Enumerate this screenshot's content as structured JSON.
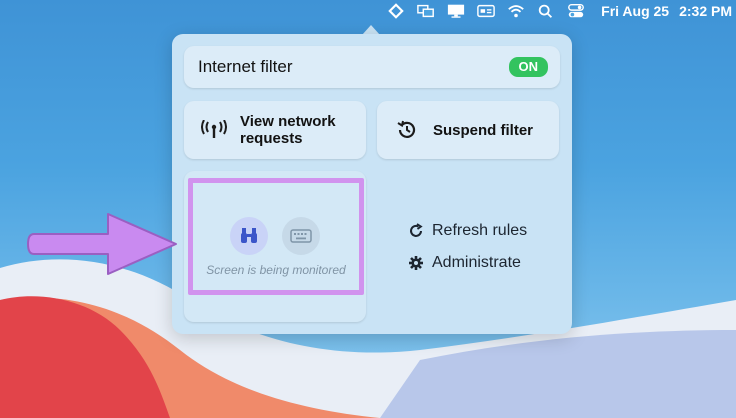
{
  "menubar": {
    "icons": [
      "app-diamond-icon",
      "screen-mirror-icon",
      "display-icon",
      "card-icon",
      "wifi-icon",
      "search-icon",
      "control-center-icon"
    ],
    "date": "Fri Aug 25",
    "time": "2:32 PM"
  },
  "panel": {
    "filter": {
      "label": "Internet filter",
      "toggle": "ON"
    },
    "network_button": {
      "line1": "View network",
      "line2": "requests"
    },
    "suspend_button": {
      "label": "Suspend filter"
    },
    "monitor": {
      "status": "Screen is being monitored"
    },
    "refresh_label": "Refresh rules",
    "admin_label": "Administrate"
  },
  "colors": {
    "toggle_on": "#33c35f",
    "highlight": "#d193ee",
    "arrow": "#c98af0"
  }
}
